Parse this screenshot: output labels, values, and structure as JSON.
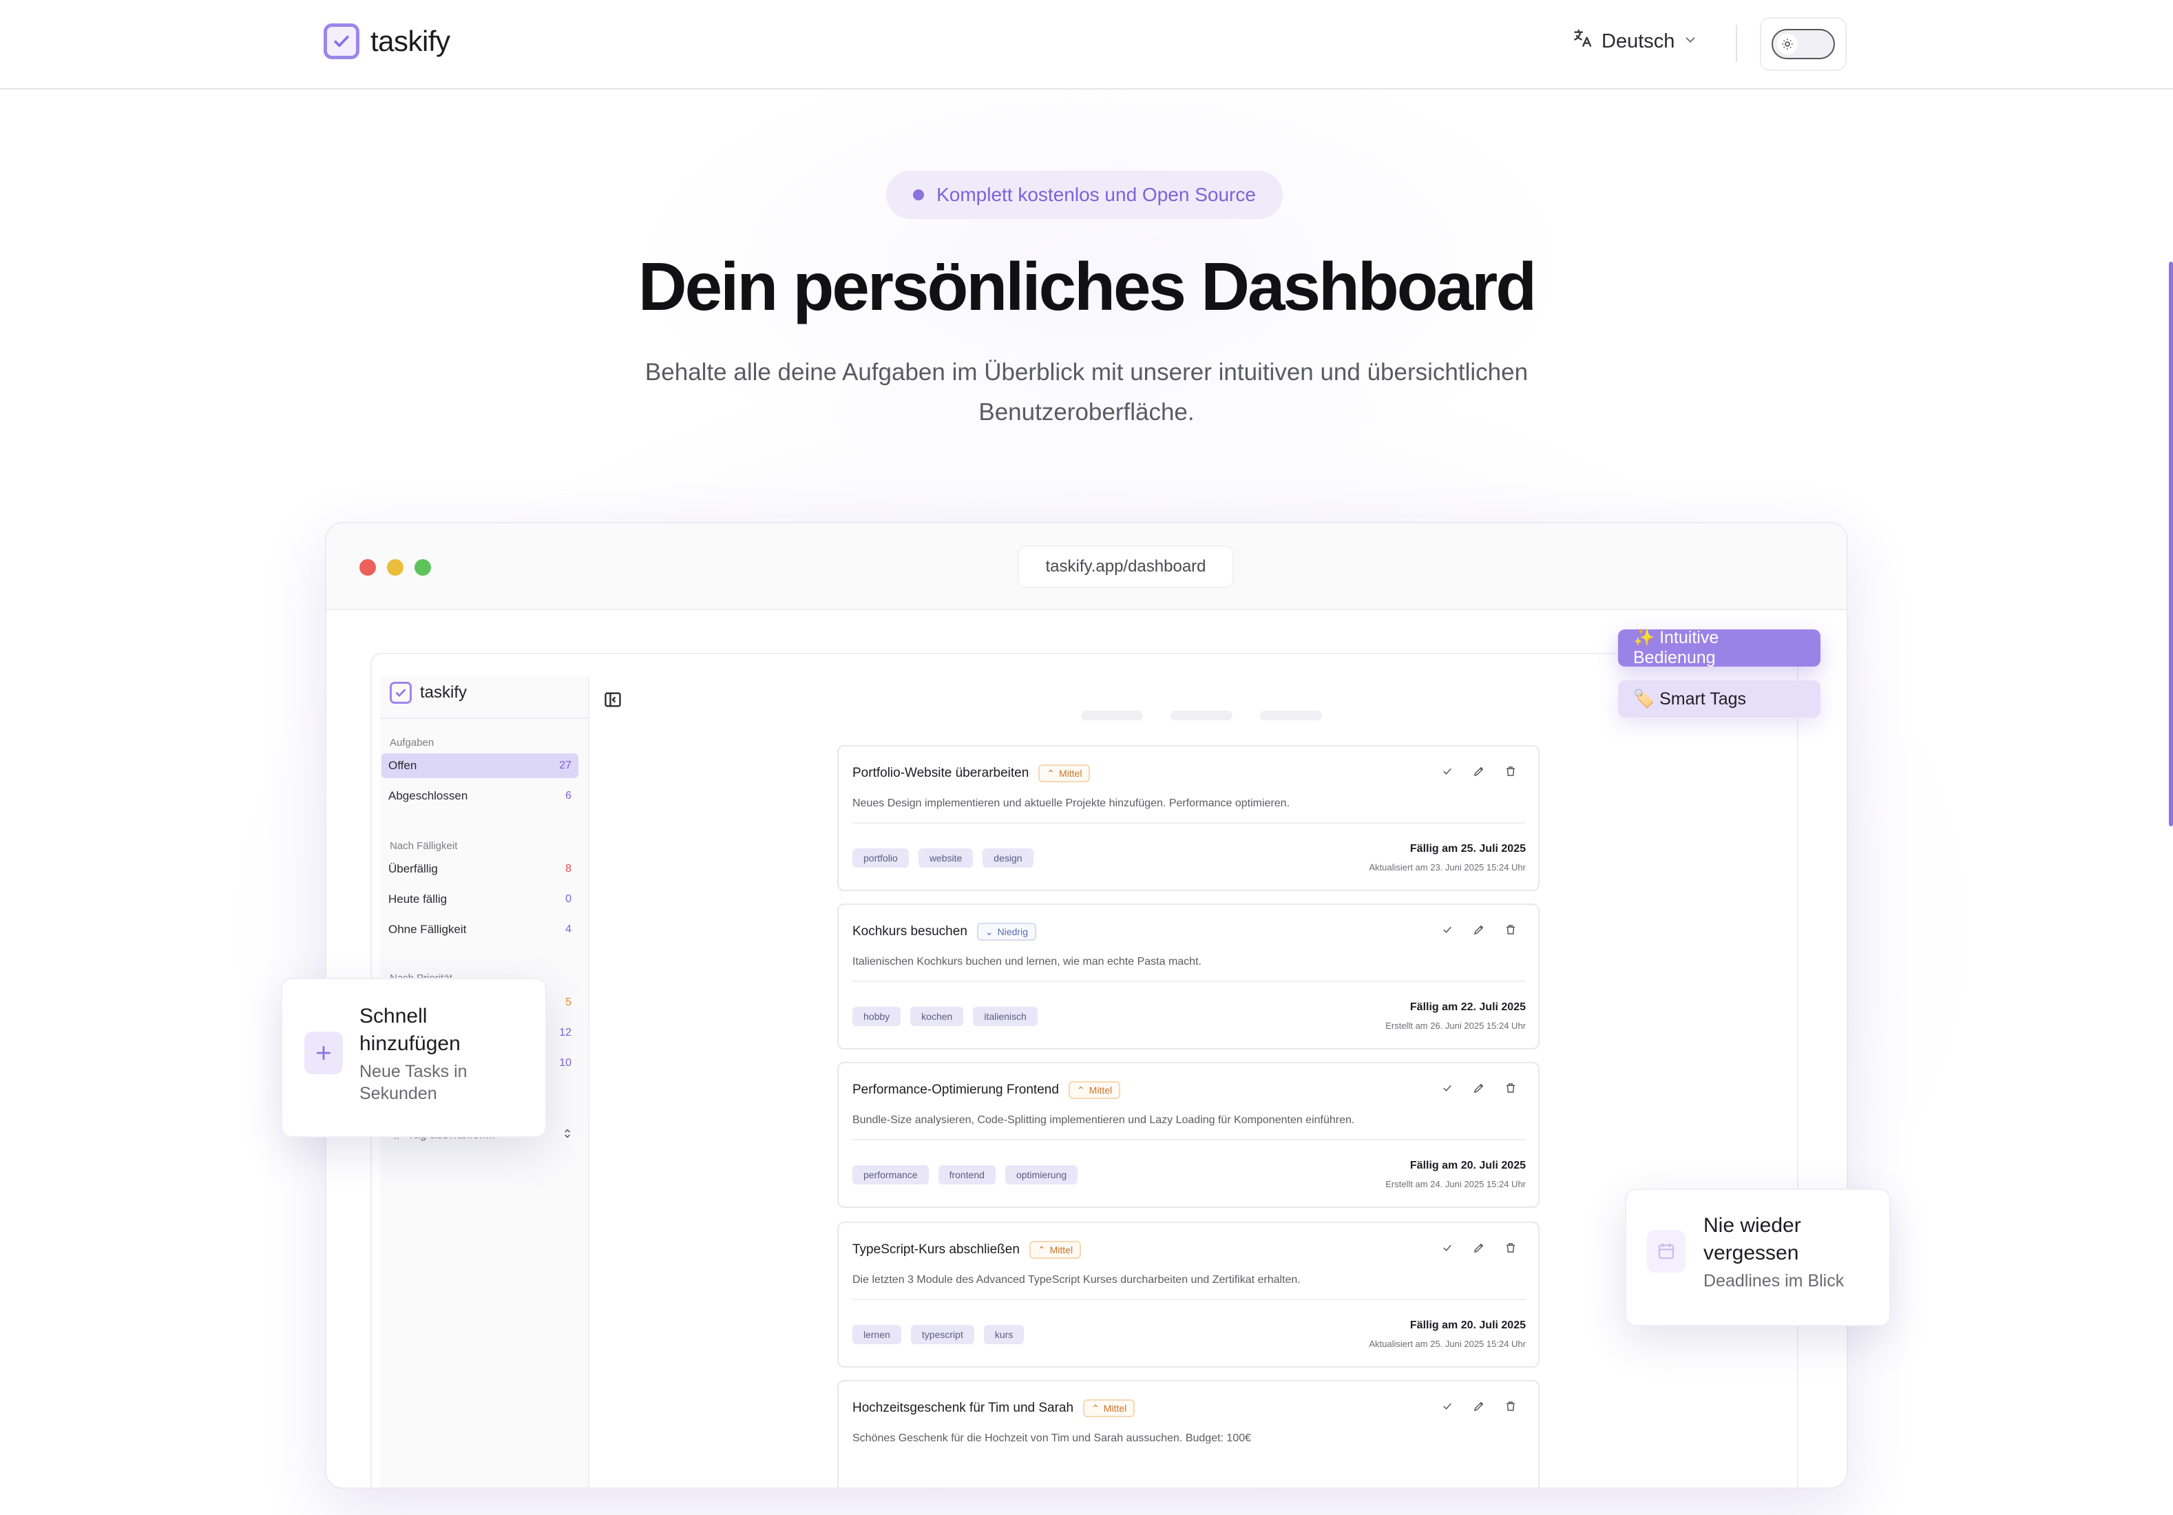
{
  "brand": {
    "name": "taskify"
  },
  "navbar": {
    "language": "Deutsch"
  },
  "hero": {
    "badge": "Komplett kostenlos und Open Source",
    "title": "Dein persönliches Dashboard",
    "subtitle": "Behalte alle deine Aufgaben im Überblick mit unserer intuitiven und übersichtlichen Benutzeroberfläche."
  },
  "browser": {
    "url": "taskify.app/dashboard"
  },
  "sidebar": {
    "brand": "taskify",
    "sections": {
      "tasks": "Aufgaben",
      "due": "Nach Fälligkeit",
      "priority": "Nach Priorität"
    },
    "items": [
      {
        "label": "Offen",
        "count": "27",
        "color": "#7c63d8"
      },
      {
        "label": "Abgeschlossen",
        "count": "6",
        "color": "#7c63d8"
      },
      {
        "label": "Überfällig",
        "count": "8",
        "color": "#e5484d"
      },
      {
        "label": "Heute fällig",
        "count": "0",
        "color": "#7c63d8"
      },
      {
        "label": "Ohne Fälligkeit",
        "count": "4",
        "color": "#7c63d8"
      }
    ],
    "priority_counts": [
      "5",
      "12",
      "10"
    ],
    "tag_select": "Tag auswählen..."
  },
  "tasks": [
    {
      "title": "Portfolio-Website überarbeiten",
      "priority": "Mittel",
      "description": "Neues Design implementieren und aktuelle Projekte hinzufügen. Performance optimieren.",
      "tags": [
        "portfolio",
        "website",
        "design"
      ],
      "due": "Fällig am 25. Juli 2025",
      "meta": "Aktualisiert am 23. Juni 2025 15:24 Uhr"
    },
    {
      "title": "Kochkurs besuchen",
      "priority": "Niedrig",
      "description": "Italienischen Kochkurs buchen und lernen, wie man echte Pasta macht.",
      "tags": [
        "hobby",
        "kochen",
        "italienisch"
      ],
      "due": "Fällig am 22. Juli 2025",
      "meta": "Erstellt am 26. Juni 2025 15:24 Uhr"
    },
    {
      "title": "Performance-Optimierung Frontend",
      "priority": "Mittel",
      "description": "Bundle-Size analysieren, Code-Splitting implementieren und Lazy Loading für Komponenten einführen.",
      "tags": [
        "performance",
        "frontend",
        "optimierung"
      ],
      "due": "Fällig am 20. Juli 2025",
      "meta": "Erstellt am 24. Juni 2025 15:24 Uhr"
    },
    {
      "title": "TypeScript-Kurs abschließen",
      "priority": "Mittel",
      "description": "Die letzten 3 Module des Advanced TypeScript Kurses durcharbeiten und Zertifikat erhalten.",
      "tags": [
        "lernen",
        "typescript",
        "kurs"
      ],
      "due": "Fällig am 20. Juli 2025",
      "meta": "Aktualisiert am 25. Juni 2025 15:24 Uhr"
    },
    {
      "title": "Hochzeitsgeschenk für Tim und Sarah",
      "priority": "Mittel",
      "description": "Schönes Geschenk für die Hochzeit von Tim und Sarah aussuchen. Budget: 100€",
      "tags": [],
      "due": "",
      "meta": ""
    }
  ],
  "floating": {
    "pill_primary": "✨ Intuitive Bedienung",
    "pill_secondary": "🏷️ Smart Tags",
    "card_left": {
      "title": "Schnell hinzufügen",
      "subtitle": "Neue Tasks in Sekunden"
    },
    "card_right": {
      "title": "Nie wieder vergessen",
      "subtitle": "Deadlines im Blick"
    }
  },
  "colors": {
    "accent": "#9b82e6",
    "badge_bg": "#efebfb",
    "priority_mid": "#c9742a",
    "priority_low": "#5b6ab0"
  },
  "icons": [
    "check-square-icon",
    "translate-icon",
    "chevron-down-icon",
    "sun-icon",
    "sidebar-collapse-icon",
    "check-icon",
    "pencil-icon",
    "trash-icon",
    "plus-icon",
    "calendar-icon",
    "hash-icon",
    "chevron-updown-icon"
  ]
}
